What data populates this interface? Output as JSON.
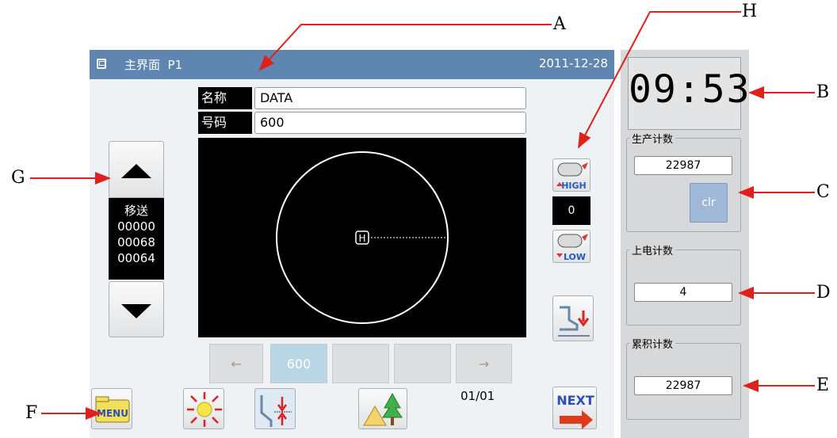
{
  "header": {
    "title": "主界面  P1",
    "date": "2011-12-28"
  },
  "pattern": {
    "name_label": "名称",
    "name_value": "DATA",
    "number_label": "号码",
    "number_value": "600"
  },
  "preview": {
    "home_marker": "H"
  },
  "feed": {
    "label": "移送",
    "values": [
      "00000",
      "00068",
      "00064"
    ]
  },
  "tension": {
    "high_label": "HIGH",
    "value": "0",
    "low_label": "LOW"
  },
  "pager": {
    "prev": "←",
    "items": [
      "600",
      "",
      ""
    ],
    "next": "→",
    "page": "01/01"
  },
  "toolbar": {
    "menu_label": "MENU",
    "next_label": "NEXT"
  },
  "clock": {
    "time": "09:53"
  },
  "counters": {
    "production_title": "生产计数",
    "production_value": "22987",
    "clear_label": "clr",
    "power_title": "上电计数",
    "power_value": "4",
    "total_title": "累积计数",
    "total_value": "22987"
  },
  "annotations": {
    "a": "A",
    "b": "B",
    "c": "C",
    "d": "D",
    "e": "E",
    "f": "F",
    "g": "G",
    "h": "H"
  },
  "colors": {
    "title_bar": "#5f86b1",
    "selected_page": "#b9d6e6",
    "arrow_red": "#e0201b",
    "panel_gray": "#d7d8da"
  }
}
